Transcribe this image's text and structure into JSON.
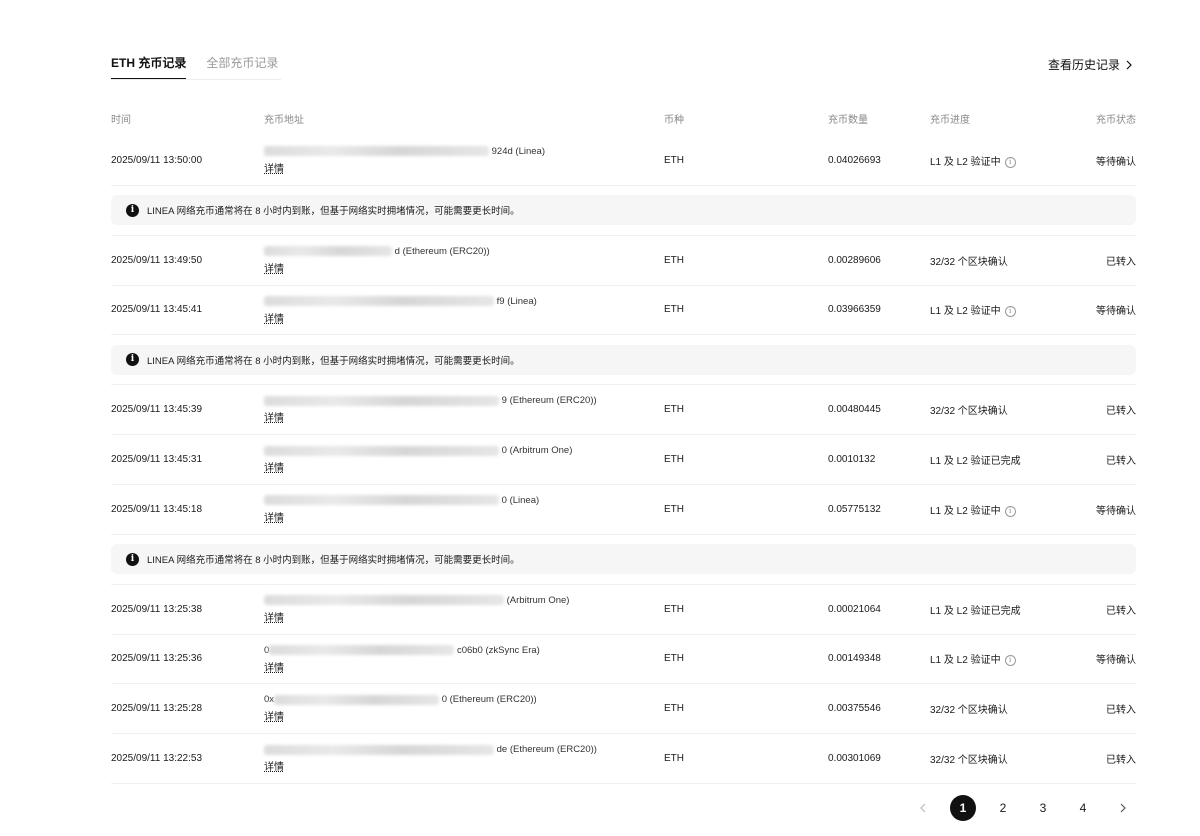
{
  "tabs": [
    {
      "label": "ETH 充币记录",
      "active": true
    },
    {
      "label": "全部充币记录",
      "active": false
    }
  ],
  "history_link": "查看历史记录",
  "columns": {
    "time": "时间",
    "address": "充币地址",
    "coin": "币种",
    "amount": "充币数量",
    "progress": "充币进度",
    "status": "充币状态"
  },
  "detail_label": "详情",
  "notice_text": "LINEA 网络充币通常将在 8 小时内到账，但基于网络实时拥堵情况，可能需要更长时间。",
  "rows": [
    {
      "time": "2025/09/11 13:50:00",
      "addr_prefix": "",
      "addr_suffix": "924d (Linea)",
      "coin": "ETH",
      "amount": "0.04026693",
      "progress": "L1 及 L2 验证中",
      "progress_info": true,
      "status": "等待确认",
      "notice": true
    },
    {
      "time": "2025/09/11 13:49:50",
      "addr_prefix": "",
      "addr_suffix": "d (Ethereum (ERC20))",
      "coin": "ETH",
      "amount": "0.00289606",
      "progress": "32/32 个区块确认",
      "progress_info": false,
      "status": "已转入",
      "notice": false
    },
    {
      "time": "2025/09/11 13:45:41",
      "addr_prefix": "",
      "addr_suffix": "f9 (Linea)",
      "coin": "ETH",
      "amount": "0.03966359",
      "progress": "L1 及 L2 验证中",
      "progress_info": true,
      "status": "等待确认",
      "notice": true
    },
    {
      "time": "2025/09/11 13:45:39",
      "addr_prefix": "",
      "addr_suffix": "9 (Ethereum (ERC20))",
      "coin": "ETH",
      "amount": "0.00480445",
      "progress": "32/32 个区块确认",
      "progress_info": false,
      "status": "已转入",
      "notice": false
    },
    {
      "time": "2025/09/11 13:45:31",
      "addr_prefix": "",
      "addr_suffix": "0 (Arbitrum One)",
      "coin": "ETH",
      "amount": "0.0010132",
      "progress": "L1 及 L2 验证已完成",
      "progress_info": false,
      "status": "已转入",
      "notice": false
    },
    {
      "time": "2025/09/11 13:45:18",
      "addr_prefix": "",
      "addr_suffix": "0 (Linea)",
      "coin": "ETH",
      "amount": "0.05775132",
      "progress": "L1 及 L2 验证中",
      "progress_info": true,
      "status": "等待确认",
      "notice": true
    },
    {
      "time": "2025/09/11 13:25:38",
      "addr_prefix": "",
      "addr_suffix": "(Arbitrum One)",
      "coin": "ETH",
      "amount": "0.00021064",
      "progress": "L1 及 L2 验证已完成",
      "progress_info": false,
      "status": "已转入",
      "notice": false
    },
    {
      "time": "2025/09/11 13:25:36",
      "addr_prefix": "0",
      "addr_suffix": "c06b0 (zkSync Era)",
      "coin": "ETH",
      "amount": "0.00149348",
      "progress": "L1 及 L2 验证中",
      "progress_info": true,
      "status": "等待确认",
      "notice": false
    },
    {
      "time": "2025/09/11 13:25:28",
      "addr_prefix": "0x",
      "addr_suffix": "0 (Ethereum (ERC20))",
      "coin": "ETH",
      "amount": "0.00375546",
      "progress": "32/32 个区块确认",
      "progress_info": false,
      "status": "已转入",
      "notice": false
    },
    {
      "time": "2025/09/11 13:22:53",
      "addr_prefix": "",
      "addr_suffix": "de (Ethereum (ERC20))",
      "coin": "ETH",
      "amount": "0.00301069",
      "progress": "32/32 个区块确认",
      "progress_info": false,
      "status": "已转入",
      "notice": false
    }
  ],
  "pagination": {
    "pages": [
      "1",
      "2",
      "3",
      "4"
    ],
    "current": "1",
    "prev_icon": "chevron-left-icon",
    "next_icon": "chevron-right-icon"
  },
  "colors": {
    "text": "#1a1a1a",
    "muted": "#8a8a8a",
    "notice_bg": "#f6f6f6",
    "active": "#111111"
  }
}
